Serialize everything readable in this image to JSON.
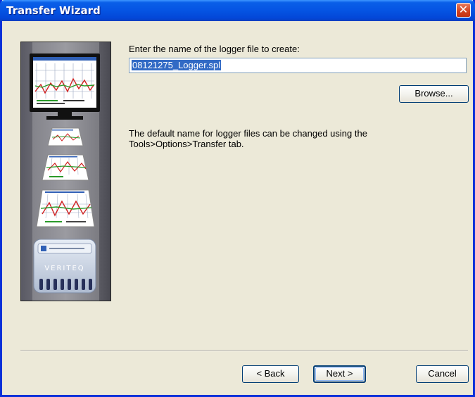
{
  "window": {
    "title": "Transfer Wizard",
    "close_glyph": "✕"
  },
  "sidepanel": {
    "brand_text": "VERITEQ",
    "icons": [
      "monitor-chart-icon",
      "logger-report-icon",
      "logger-device-icon"
    ]
  },
  "content": {
    "prompt_label": "Enter the name of the logger file to create:",
    "filename_value": "08121275_Logger.spl",
    "browse_label": "Browse...",
    "info_text": "The default name for logger files can be changed using the Tools>Options>Transfer tab."
  },
  "footer": {
    "back_label": "< Back",
    "next_label": "Next >",
    "cancel_label": "Cancel"
  },
  "colors": {
    "titlebar": "#0554E3",
    "dialog_bg": "#ECE9D8",
    "selection": "#316AC5",
    "close": "#D3411E"
  }
}
